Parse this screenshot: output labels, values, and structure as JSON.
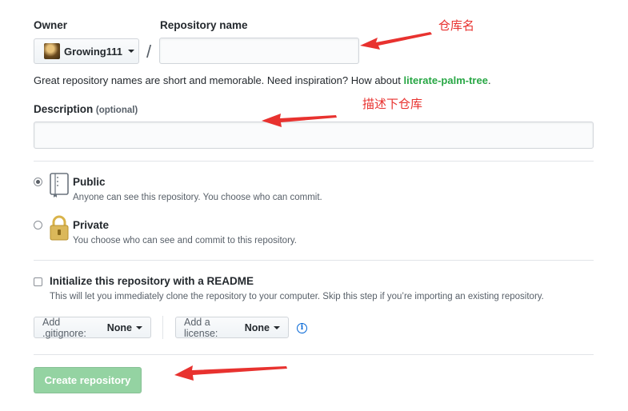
{
  "owner": {
    "label": "Owner",
    "value": "Growing111"
  },
  "repo_name": {
    "label": "Repository name",
    "value": "",
    "slash": "/"
  },
  "hint": {
    "text": "Great repository names are short and memorable. Need inspiration? How about ",
    "suggestion": "literate-palm-tree",
    "end": "."
  },
  "description": {
    "label": "Description",
    "optional": "(optional)",
    "value": ""
  },
  "visibility": {
    "public": {
      "title": "Public",
      "desc": "Anyone can see this repository. You choose who can commit.",
      "selected": true
    },
    "private": {
      "title": "Private",
      "desc": "You choose who can see and commit to this repository.",
      "selected": false
    }
  },
  "readme": {
    "title": "Initialize this repository with a README",
    "desc": "This will let you immediately clone the repository to your computer. Skip this step if you’re importing an existing repository.",
    "checked": false
  },
  "gitignore": {
    "label": "Add .gitignore:",
    "value": "None"
  },
  "license": {
    "label": "Add a license:",
    "value": "None"
  },
  "info_icon": "i",
  "create_button": "Create repository",
  "annotations": {
    "repo_name": "仓库名",
    "description": "描述下仓库"
  },
  "colors": {
    "accent_green": "#28a745",
    "button_disabled_green": "#94d3a2",
    "annotation_red": "#e8322f",
    "link_blue": "#0366d6"
  },
  "icons": {
    "repo": "repo-book-icon",
    "lock": "lock-icon",
    "info": "info-icon",
    "arrow": "red-arrow-annotation"
  }
}
